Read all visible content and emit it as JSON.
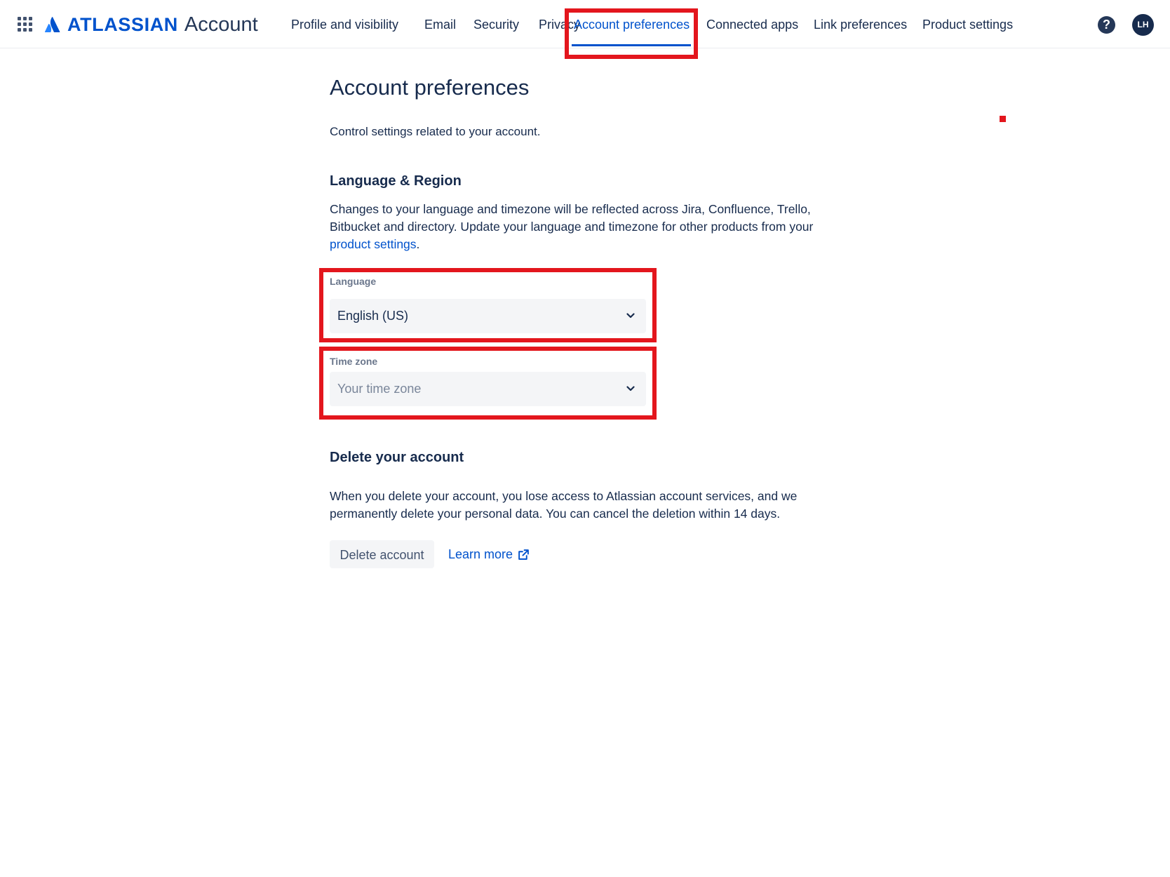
{
  "brand": {
    "wordmark": "ATLASSIAN",
    "product": "Account"
  },
  "nav": {
    "items": [
      {
        "label": "Profile and visibility"
      },
      {
        "label": "Email"
      },
      {
        "label": "Security"
      },
      {
        "label": "Privacy"
      },
      {
        "label": "Account preferences",
        "active": true
      },
      {
        "label": "Connected apps"
      },
      {
        "label": "Link preferences"
      },
      {
        "label": "Product settings"
      }
    ],
    "help_symbol": "?",
    "avatar_initials": "LH"
  },
  "page": {
    "title": "Account preferences",
    "description": "Control settings related to your account."
  },
  "language_region": {
    "heading": "Language & Region",
    "text_before_link": "Changes to your language and timezone will be reflected across Jira, Confluence, Trello, Bitbucket and directory. Update your language and timezone for other products from your ",
    "link_text": "product settings",
    "text_after_link": ".",
    "language_label": "Language",
    "language_value": "English (US)",
    "timezone_label": "Time zone",
    "timezone_placeholder": "Your time zone"
  },
  "delete_account": {
    "heading": "Delete your account",
    "text": "When you delete your account, you lose access to Atlassian account services, and we permanently delete your personal data. You can cancel the deletion within 14 days.",
    "button_label": "Delete account",
    "learn_more_label": "Learn more"
  },
  "colors": {
    "brand_blue": "#0052cc",
    "text": "#172b4d",
    "annotation_red": "#e3161d"
  },
  "icons": [
    "app-switcher-icon",
    "atlassian-logo-icon",
    "help-icon",
    "chevron-down-icon",
    "external-link-icon"
  ]
}
